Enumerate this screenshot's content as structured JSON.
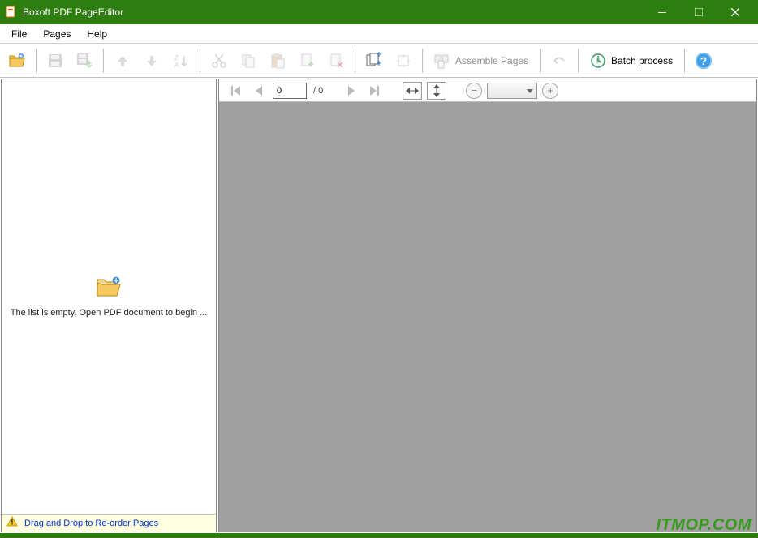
{
  "window": {
    "title": "Boxoft PDF PageEditor"
  },
  "menu": {
    "file": "File",
    "pages": "Pages",
    "help": "Help"
  },
  "toolbar": {
    "assemble_label": "Assemble Pages",
    "batch_label": "Batch process"
  },
  "sidebar": {
    "empty_text": "The list is empty. Open  PDF document to begin ...",
    "hint": "Drag and Drop to Re-order Pages"
  },
  "preview": {
    "current_page": "0",
    "total_pages": "/ 0",
    "zoom_value": ""
  },
  "watermark": "ITMOP.COM",
  "colors": {
    "titlebar": "#2e7d0f",
    "canvas": "#a0a0a0",
    "hint_bg": "#ffffe1",
    "hint_fg": "#0033cc"
  }
}
